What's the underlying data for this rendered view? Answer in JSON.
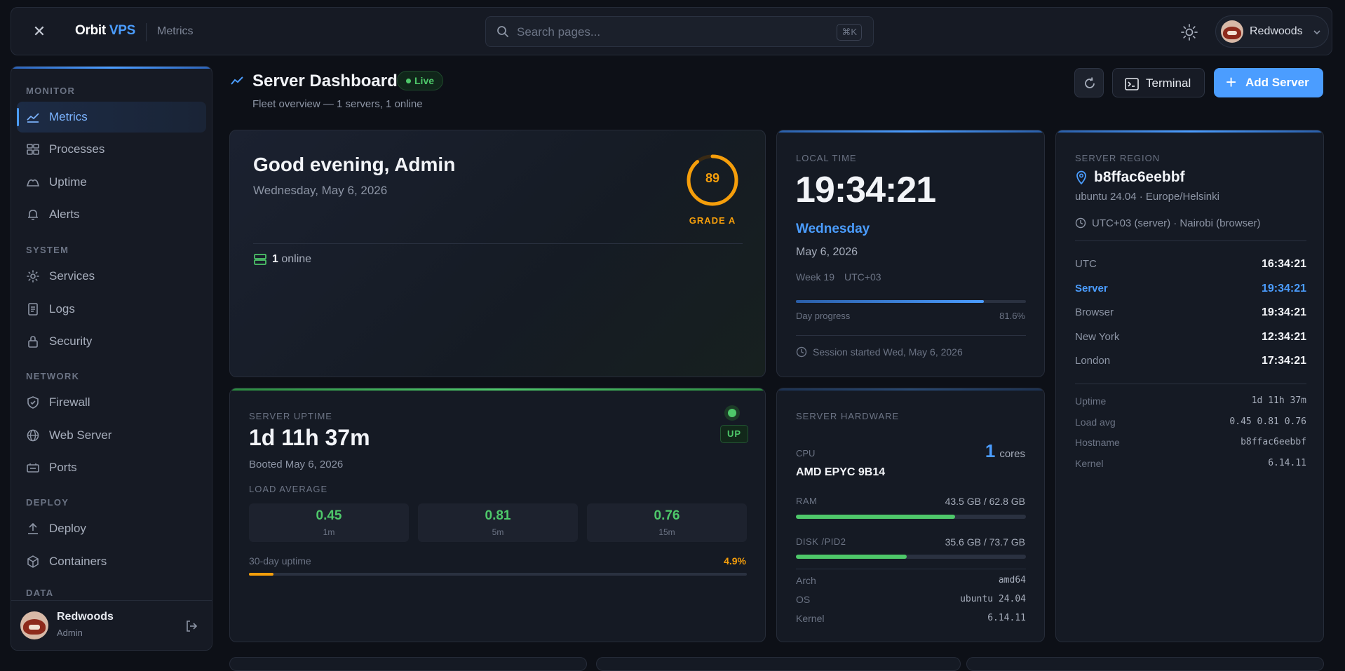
{
  "app": {
    "brand_main": "Orbit",
    "brand_accent": "VPS",
    "section": "Metrics",
    "search_placeholder": "Search pages...",
    "search_shortcut": "⌘K",
    "user_name": "Redwoods"
  },
  "sidebar": {
    "sections": {
      "monitor": "MONITOR",
      "system": "SYSTEM",
      "network": "NETWORK",
      "deploy": "DEPLOY",
      "data": "DATA"
    },
    "items": [
      {
        "label": "Metrics",
        "icon": "chart-line-icon"
      },
      {
        "label": "Processes",
        "icon": "grid-icon"
      },
      {
        "label": "Uptime",
        "icon": "cloud-icon"
      },
      {
        "label": "Alerts",
        "icon": "bell-icon"
      },
      {
        "label": "Services",
        "icon": "sun-gear-icon"
      },
      {
        "label": "Logs",
        "icon": "document-icon"
      },
      {
        "label": "Security",
        "icon": "lock-icon"
      },
      {
        "label": "Firewall",
        "icon": "shield-icon"
      },
      {
        "label": "Web Server",
        "icon": "globe-icon"
      },
      {
        "label": "Ports",
        "icon": "port-icon"
      },
      {
        "label": "Deploy",
        "icon": "upload-icon"
      },
      {
        "label": "Containers",
        "icon": "box-icon"
      }
    ],
    "footer": {
      "name": "Redwoods",
      "role": "Admin"
    }
  },
  "header": {
    "title": "Server Dashboard",
    "badge": "Live",
    "subtitle": "Fleet overview — 1 servers, 1 online",
    "terminal_label": "Terminal",
    "add_label": "Add Server"
  },
  "greeting": {
    "title": "Good evening, Admin",
    "date": "Wednesday, May 6, 2026",
    "score": "89",
    "score_fraction": 0.89,
    "grade": "GRADE A",
    "online_count": "1",
    "online_label": "online"
  },
  "local_time": {
    "label": "LOCAL TIME",
    "clock": "19:34:21",
    "weekday": "Wednesday",
    "date": "May 6, 2026",
    "week": "Week 19",
    "utc": "UTC+03",
    "progress_label": "Day progress",
    "progress_pct": "81.6%",
    "progress_value": 0.816,
    "session": "Session started Wed, May 6, 2026"
  },
  "region": {
    "label": "SERVER REGION",
    "host": "b8ffac6eebbf",
    "os_loc": "ubuntu 24.04 · Europe/Helsinki",
    "tz": "UTC+03 (server) · Nairobi (browser)",
    "clocks": [
      {
        "k": "UTC",
        "v": "16:34:21"
      },
      {
        "k": "Server",
        "v": "19:34:21"
      },
      {
        "k": "Browser",
        "v": "19:34:21"
      },
      {
        "k": "New York",
        "v": "12:34:21"
      },
      {
        "k": "London",
        "v": "17:34:21"
      }
    ],
    "info": [
      {
        "k": "Uptime",
        "v": "1d 11h 37m"
      },
      {
        "k": "Load avg",
        "v": "0.45 0.81 0.76"
      },
      {
        "k": "Hostname",
        "v": "b8ffac6eebbf"
      },
      {
        "k": "Kernel",
        "v": "6.14.11"
      }
    ]
  },
  "uptime": {
    "label": "SERVER UPTIME",
    "value": "1d 11h 37m",
    "booted": "Booted May 6, 2026",
    "status": "UP",
    "load_label": "LOAD AVERAGE",
    "loads": [
      {
        "v": "0.45",
        "k": "1m"
      },
      {
        "v": "0.81",
        "k": "5m"
      },
      {
        "v": "0.76",
        "k": "15m"
      }
    ],
    "uptime30_label": "30-day uptime",
    "uptime30_pct": "4.9%",
    "uptime30_value": 0.049
  },
  "hardware": {
    "label": "SERVER HARDWARE",
    "cpu_label": "CPU",
    "cores": "1",
    "cores_label": "cores",
    "cpu_model": "AMD EPYC 9B14",
    "ram_label": "RAM",
    "ram_value": "43.5 GB / 62.8 GB",
    "ram_fraction": 0.693,
    "disk_label": "DISK /PID2",
    "disk_value": "35.6 GB / 73.7 GB",
    "disk_fraction": 0.483,
    "specs": [
      {
        "k": "Arch",
        "v": "amd64"
      },
      {
        "k": "OS",
        "v": "ubuntu 24.04"
      },
      {
        "k": "Kernel",
        "v": "6.14.11"
      }
    ]
  },
  "colors": {
    "accent": "#4b9dff",
    "success": "#4ec86a",
    "warning": "#f59e0b",
    "background": "#0d1017",
    "card": "#151a24"
  }
}
